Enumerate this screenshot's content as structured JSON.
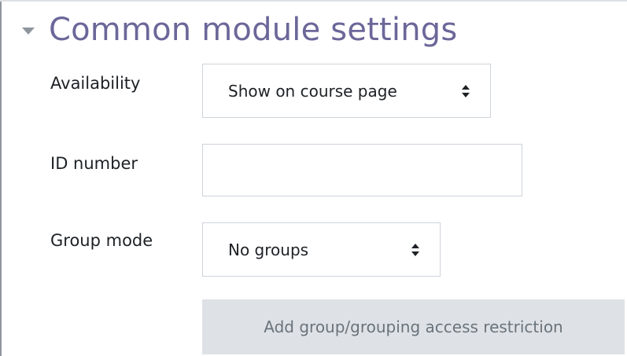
{
  "section": {
    "title": "Common module settings",
    "expanded": true
  },
  "availability": {
    "label": "Availability",
    "selected": "Show on course page"
  },
  "id_number": {
    "label": "ID number",
    "value": ""
  },
  "group_mode": {
    "label": "Group mode",
    "selected": "No groups"
  },
  "restriction_button": {
    "label": "Add group/grouping access restriction",
    "disabled": true
  },
  "colors": {
    "section_title": "#6b6799",
    "label_text": "#1d2125",
    "input_border": "#ced4da",
    "button_bg": "#dee2e6",
    "button_text": "#6a737b",
    "caret": "#8f959e"
  },
  "icons": {
    "section_toggle": "caret-down-icon",
    "select_arrow": "up-down-arrow-icon"
  }
}
